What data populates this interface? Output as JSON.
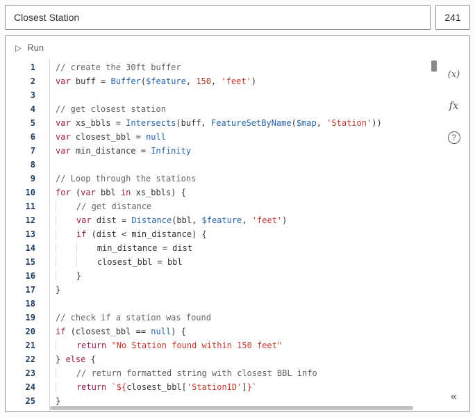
{
  "header": {
    "title_value": "Closest Station",
    "char_count": "241"
  },
  "toolbar": {
    "run_icon": "▷",
    "run_label": "Run"
  },
  "sidebar": {
    "globals_icon": "(x)",
    "functions_icon": "fx",
    "help_icon": "?",
    "collapse_icon": "«"
  },
  "colors": {
    "keyword": "#9b1d4f",
    "string": "#c5372c",
    "number": "#a0341f",
    "function": "#2463a8",
    "global": "#2463a8",
    "constant": "#2463a8",
    "comment": "#616161",
    "plain": "#333333",
    "linenum": "#1f3a5f"
  },
  "editor": {
    "lines": [
      {
        "n": 1,
        "indent": 0,
        "tokens": [
          [
            "c",
            "// create the 30ft buffer"
          ]
        ]
      },
      {
        "n": 2,
        "indent": 0,
        "tokens": [
          [
            "k",
            "var"
          ],
          [
            "p",
            " buff = "
          ],
          [
            "f",
            "Buffer"
          ],
          [
            "p",
            "("
          ],
          [
            "g",
            "$feature"
          ],
          [
            "p",
            ", "
          ],
          [
            "n",
            "150"
          ],
          [
            "p",
            ", "
          ],
          [
            "s",
            "'feet'"
          ],
          [
            "p",
            ")"
          ]
        ]
      },
      {
        "n": 3,
        "indent": 0,
        "tokens": []
      },
      {
        "n": 4,
        "indent": 0,
        "tokens": [
          [
            "c",
            "// get closest station"
          ]
        ]
      },
      {
        "n": 5,
        "indent": 0,
        "tokens": [
          [
            "k",
            "var"
          ],
          [
            "p",
            " xs_bbls = "
          ],
          [
            "f",
            "Intersects"
          ],
          [
            "p",
            "(buff, "
          ],
          [
            "f",
            "FeatureSetByName"
          ],
          [
            "p",
            "("
          ],
          [
            "g",
            "$map"
          ],
          [
            "p",
            ", "
          ],
          [
            "s",
            "'Station'"
          ],
          [
            "p",
            "))"
          ]
        ]
      },
      {
        "n": 6,
        "indent": 0,
        "tokens": [
          [
            "k",
            "var"
          ],
          [
            "p",
            " closest_bbl = "
          ],
          [
            "b",
            "null"
          ]
        ]
      },
      {
        "n": 7,
        "indent": 0,
        "tokens": [
          [
            "k",
            "var"
          ],
          [
            "p",
            " min_distance = "
          ],
          [
            "b",
            "Infinity"
          ]
        ]
      },
      {
        "n": 8,
        "indent": 0,
        "tokens": []
      },
      {
        "n": 9,
        "indent": 0,
        "tokens": [
          [
            "c",
            "// Loop through the stations"
          ]
        ]
      },
      {
        "n": 10,
        "indent": 0,
        "tokens": [
          [
            "k",
            "for"
          ],
          [
            "p",
            " ("
          ],
          [
            "k",
            "var"
          ],
          [
            "p",
            " bbl "
          ],
          [
            "k",
            "in"
          ],
          [
            "p",
            " xs_bbls) {"
          ]
        ]
      },
      {
        "n": 11,
        "indent": 4,
        "tokens": [
          [
            "c",
            "// get distance"
          ]
        ]
      },
      {
        "n": 12,
        "indent": 4,
        "tokens": [
          [
            "k",
            "var"
          ],
          [
            "p",
            " dist = "
          ],
          [
            "f",
            "Distance"
          ],
          [
            "p",
            "(bbl, "
          ],
          [
            "g",
            "$feature"
          ],
          [
            "p",
            ", "
          ],
          [
            "s",
            "'feet'"
          ],
          [
            "p",
            ")"
          ]
        ]
      },
      {
        "n": 13,
        "indent": 4,
        "tokens": [
          [
            "k",
            "if"
          ],
          [
            "p",
            " (dist < min_distance) {"
          ]
        ]
      },
      {
        "n": 14,
        "indent": 8,
        "tokens": [
          [
            "p",
            "min_distance = dist"
          ]
        ]
      },
      {
        "n": 15,
        "indent": 8,
        "tokens": [
          [
            "p",
            "closest_bbl = bbl"
          ]
        ]
      },
      {
        "n": 16,
        "indent": 4,
        "tokens": [
          [
            "p",
            "}"
          ]
        ]
      },
      {
        "n": 17,
        "indent": 0,
        "tokens": [
          [
            "p",
            "}"
          ]
        ]
      },
      {
        "n": 18,
        "indent": 0,
        "tokens": []
      },
      {
        "n": 19,
        "indent": 0,
        "tokens": [
          [
            "c",
            "// check if a station was found"
          ]
        ]
      },
      {
        "n": 20,
        "indent": 0,
        "tokens": [
          [
            "k",
            "if"
          ],
          [
            "p",
            " (closest_bbl == "
          ],
          [
            "b",
            "null"
          ],
          [
            "p",
            ") {"
          ]
        ]
      },
      {
        "n": 21,
        "indent": 4,
        "tokens": [
          [
            "k",
            "return"
          ],
          [
            "p",
            " "
          ],
          [
            "s",
            "\"No Station found within 150 feet\""
          ]
        ]
      },
      {
        "n": 22,
        "indent": 0,
        "tokens": [
          [
            "p",
            "} "
          ],
          [
            "k",
            "else"
          ],
          [
            "p",
            " {"
          ]
        ]
      },
      {
        "n": 23,
        "indent": 4,
        "tokens": [
          [
            "c",
            "// return formatted string with closest BBL info"
          ]
        ]
      },
      {
        "n": 24,
        "indent": 4,
        "tokens": [
          [
            "k",
            "return"
          ],
          [
            "p",
            " "
          ],
          [
            "s",
            "`${"
          ],
          [
            "p",
            "closest_bbl["
          ],
          [
            "s",
            "'StationID'"
          ],
          [
            "p",
            "]"
          ],
          [
            "s",
            "}`"
          ]
        ]
      },
      {
        "n": 25,
        "indent": 0,
        "tokens": [
          [
            "p",
            "}"
          ]
        ]
      }
    ]
  }
}
